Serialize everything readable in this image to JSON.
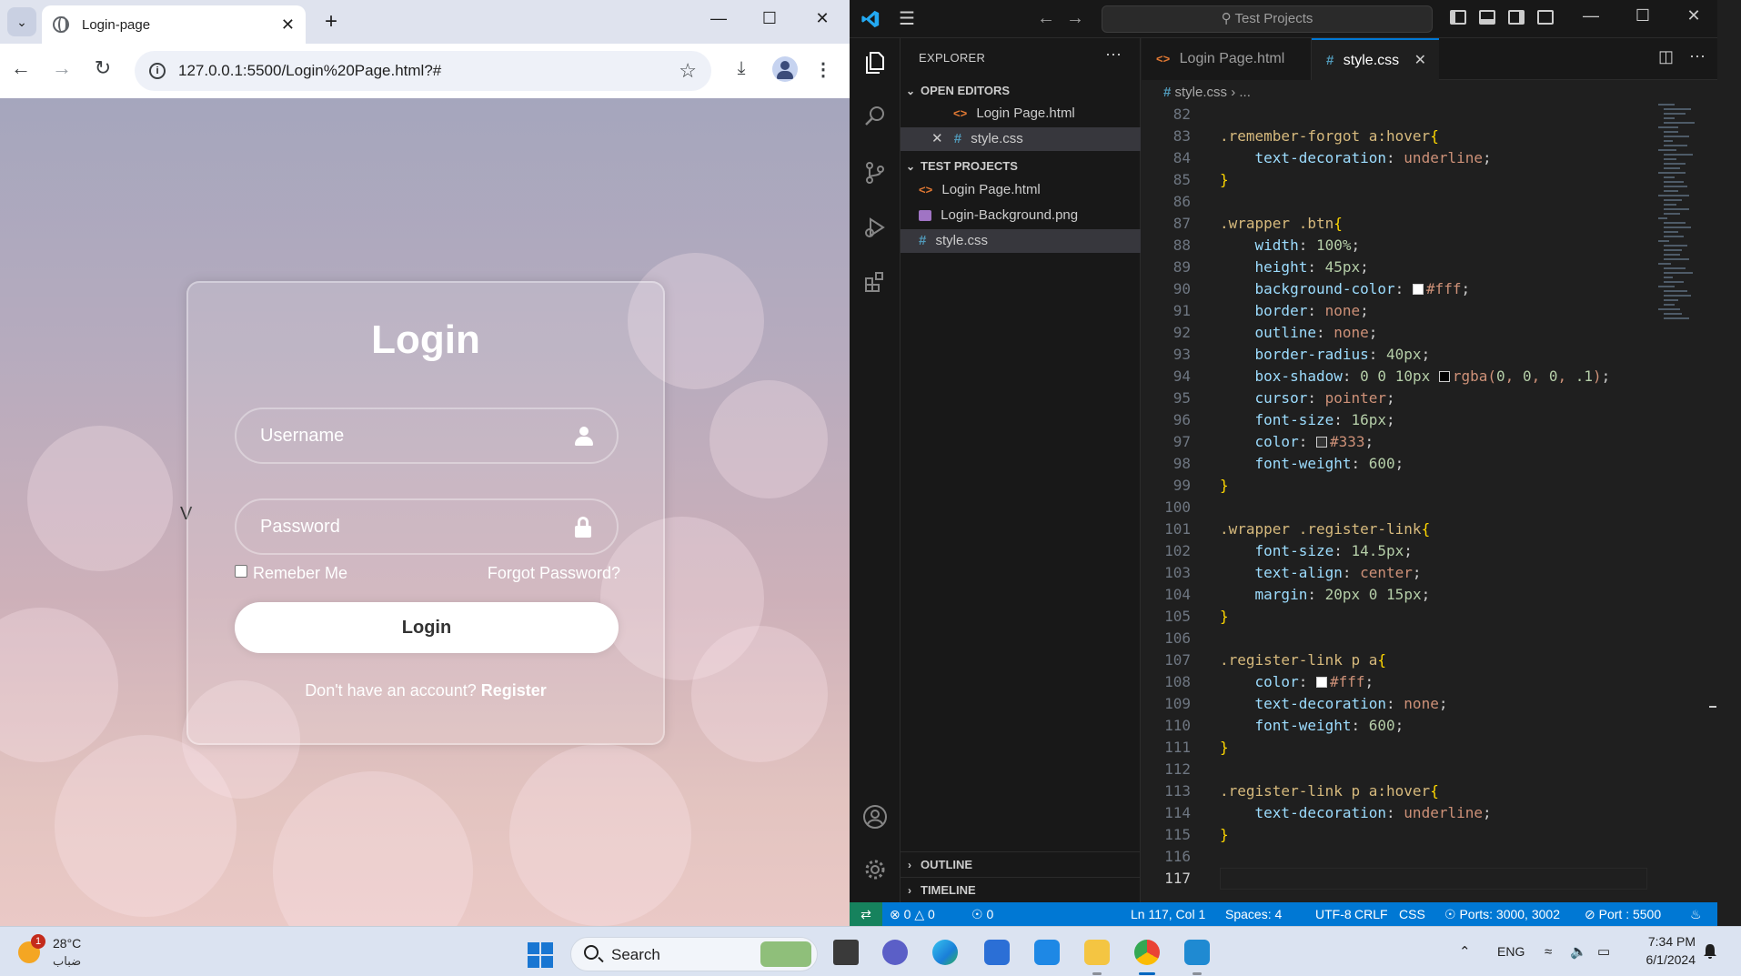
{
  "browser": {
    "tab_title": "Login-page",
    "url": "127.0.0.1:5500/Login%20Page.html?#"
  },
  "login_page": {
    "stray_text": "V",
    "title": "Login",
    "username_placeholder": "Username",
    "password_placeholder": "Password",
    "remember_label": "Remeber Me",
    "forgot_link": "Forgot Password?",
    "login_button": "Login",
    "register_prompt": "Don't have an account?",
    "register_link": "Register"
  },
  "vscode": {
    "search_text": "Test Projects",
    "explorer_title": "EXPLORER",
    "open_editors_title": "OPEN EDITORS",
    "open_editors": [
      {
        "name": "Login Page.html",
        "type": "html"
      },
      {
        "name": "style.css",
        "type": "css"
      }
    ],
    "project_title": "TEST PROJECTS",
    "project_files": [
      {
        "name": "Login Page.html",
        "type": "html"
      },
      {
        "name": "Login-Background.png",
        "type": "png"
      },
      {
        "name": "style.css",
        "type": "css"
      }
    ],
    "outline_title": "OUTLINE",
    "timeline_title": "TIMELINE",
    "tabs": [
      {
        "name": "Login Page.html",
        "type": "html"
      },
      {
        "name": "style.css",
        "type": "css"
      }
    ],
    "breadcrumb_file": "style.css",
    "breadcrumb_rest": "...",
    "current_line": 117,
    "code_lines": [
      {
        "n": 82,
        "t": ""
      },
      {
        "n": 83,
        "t": ".remember-forgot a:hover{"
      },
      {
        "n": 84,
        "t": "    text-decoration: underline;"
      },
      {
        "n": 85,
        "t": "}"
      },
      {
        "n": 86,
        "t": ""
      },
      {
        "n": 87,
        "t": ".wrapper .btn{"
      },
      {
        "n": 88,
        "t": "    width: 100%;"
      },
      {
        "n": 89,
        "t": "    height: 45px;"
      },
      {
        "n": 90,
        "t": "    background-color: #fff;"
      },
      {
        "n": 91,
        "t": "    border: none;"
      },
      {
        "n": 92,
        "t": "    outline: none;"
      },
      {
        "n": 93,
        "t": "    border-radius: 40px;"
      },
      {
        "n": 94,
        "t": "    box-shadow: 0 0 10px rgba(0, 0, 0, .1);"
      },
      {
        "n": 95,
        "t": "    cursor: pointer;"
      },
      {
        "n": 96,
        "t": "    font-size: 16px;"
      },
      {
        "n": 97,
        "t": "    color: #333;"
      },
      {
        "n": 98,
        "t": "    font-weight: 600;"
      },
      {
        "n": 99,
        "t": "}"
      },
      {
        "n": 100,
        "t": ""
      },
      {
        "n": 101,
        "t": ".wrapper .register-link{"
      },
      {
        "n": 102,
        "t": "    font-size: 14.5px;"
      },
      {
        "n": 103,
        "t": "    text-align: center;"
      },
      {
        "n": 104,
        "t": "    margin: 20px 0 15px;"
      },
      {
        "n": 105,
        "t": "}"
      },
      {
        "n": 106,
        "t": ""
      },
      {
        "n": 107,
        "t": ".register-link p a{"
      },
      {
        "n": 108,
        "t": "    color: #fff;"
      },
      {
        "n": 109,
        "t": "    text-decoration: none;"
      },
      {
        "n": 110,
        "t": "    font-weight: 600;"
      },
      {
        "n": 111,
        "t": "}"
      },
      {
        "n": 112,
        "t": ""
      },
      {
        "n": 113,
        "t": ".register-link p a:hover{"
      },
      {
        "n": 114,
        "t": "    text-decoration: underline;"
      },
      {
        "n": 115,
        "t": "}"
      },
      {
        "n": 116,
        "t": ""
      },
      {
        "n": 117,
        "t": ""
      }
    ],
    "status": {
      "errors": "0",
      "warnings": "0",
      "ports_forwarded": "0",
      "position": "Ln 117, Col 1",
      "spaces": "Spaces: 4",
      "encoding": "UTF-8",
      "eol": "CRLF",
      "language": "CSS",
      "ports": "Ports: 3000, 3002",
      "live_server": "Port : 5500"
    }
  },
  "taskbar": {
    "weather_temp": "28°C",
    "weather_desc": "ضباب",
    "weather_badge": "1",
    "search_label": "Search",
    "language": "ENG",
    "time": "7:34 PM",
    "date": "6/1/2024"
  },
  "colors": {
    "vscode_accent": "#0078d4",
    "html_icon": "#e37933",
    "css_icon": "#519aba"
  }
}
